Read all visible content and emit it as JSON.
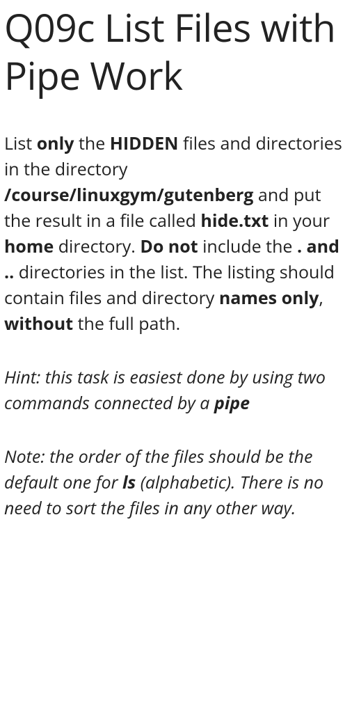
{
  "title": "Q09c List Files with Pipe Work",
  "p1": {
    "s0": "List ",
    "only": "only",
    "s1": " the ",
    "hidden": "HIDDEN",
    "s2": " files and directories in the directory ",
    "path": "/course/linuxgym/gutenberg",
    "s3": " and put the result in a file called ",
    "hidetxt": "hide.txt",
    "s4": " in your ",
    "home": "home",
    "s5": " directory. ",
    "donot": "Do not",
    "s6": " include the ",
    "dots": ". and ..",
    "s7": " directories in the list. The listing should contain files and directory ",
    "namesonly": "names only",
    "s8": ", ",
    "without": "without",
    "s9": " the full path."
  },
  "p2": {
    "s0": "Hint: this task is easiest done by using two commands connected by a ",
    "pipe": "pipe"
  },
  "p3": {
    "s0": "Note: the order of the files should be the default one for ",
    "ls": "ls",
    "s1": " (alphabetic). There is no need to sort the files in any other way."
  }
}
